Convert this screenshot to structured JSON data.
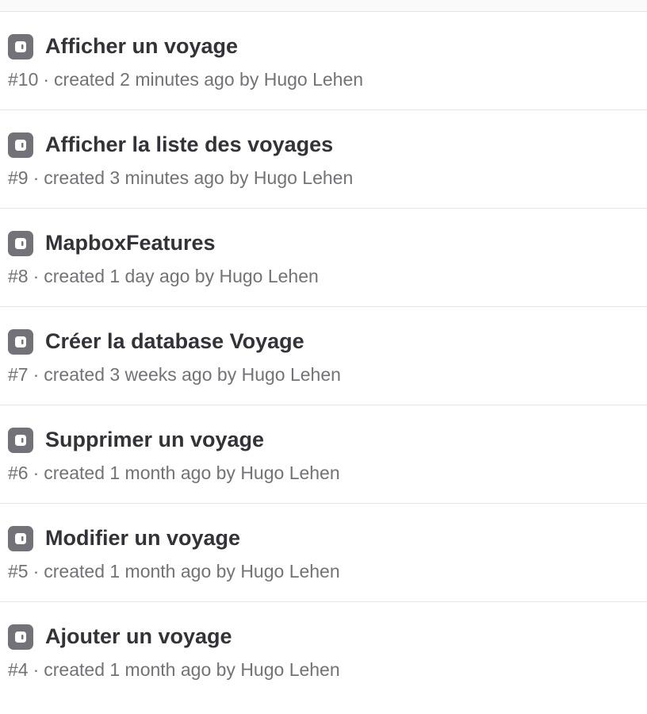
{
  "issues": [
    {
      "title": "Afficher un voyage",
      "number": "#10",
      "separator": "·",
      "created": "created 2 minutes ago by Hugo Lehen",
      "icon": "issue-type-icon"
    },
    {
      "title": "Afficher la liste des voyages",
      "number": "#9",
      "separator": "·",
      "created": "created 3 minutes ago by Hugo Lehen",
      "icon": "issue-type-icon"
    },
    {
      "title": "MapboxFeatures",
      "number": "#8",
      "separator": "·",
      "created": "created 1 day ago by Hugo Lehen",
      "icon": "issue-type-icon"
    },
    {
      "title": "Créer la database Voyage",
      "number": "#7",
      "separator": "·",
      "created": "created 3 weeks ago by Hugo Lehen",
      "icon": "issue-type-icon"
    },
    {
      "title": "Supprimer un voyage",
      "number": "#6",
      "separator": "·",
      "created": "created 1 month ago by Hugo Lehen",
      "icon": "issue-type-icon"
    },
    {
      "title": "Modifier un voyage",
      "number": "#5",
      "separator": "·",
      "created": "created 1 month ago by Hugo Lehen",
      "icon": "issue-type-icon"
    },
    {
      "title": "Ajouter un voyage",
      "number": "#4",
      "separator": "·",
      "created": "created 1 month ago by Hugo Lehen",
      "icon": "issue-type-icon"
    }
  ],
  "colors": {
    "icon_bg": "#737278",
    "title": "#333238",
    "meta": "#737278",
    "divider": "#e4e4e7"
  }
}
